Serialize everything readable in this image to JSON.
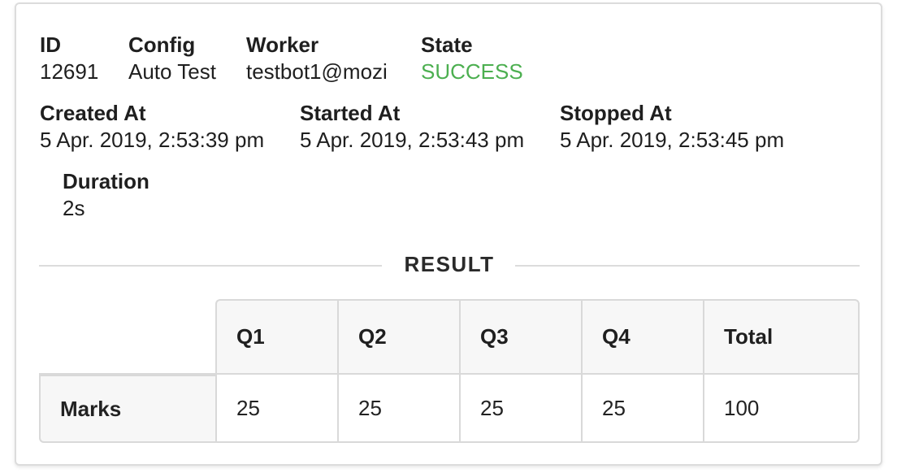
{
  "details": {
    "id_label": "ID",
    "id_value": "12691",
    "config_label": "Config",
    "config_value": "Auto Test",
    "worker_label": "Worker",
    "worker_value": "testbot1@mozi",
    "state_label": "State",
    "state_value": "SUCCESS",
    "created_label": "Created At",
    "created_value": "5 Apr. 2019, 2:53:39 pm",
    "started_label": "Started At",
    "started_value": "5 Apr. 2019, 2:53:43 pm",
    "stopped_label": "Stopped At",
    "stopped_value": "5 Apr. 2019, 2:53:45 pm",
    "duration_label": "Duration",
    "duration_value": "2s"
  },
  "colors": {
    "success": "#4caf50",
    "border": "#dcdcdc",
    "header_bg": "#f7f7f7"
  },
  "result": {
    "title": "RESULT",
    "columns": [
      "Q1",
      "Q2",
      "Q3",
      "Q4",
      "Total"
    ],
    "rows": [
      {
        "label": "Marks",
        "values": [
          "25",
          "25",
          "25",
          "25",
          "100"
        ]
      }
    ]
  }
}
